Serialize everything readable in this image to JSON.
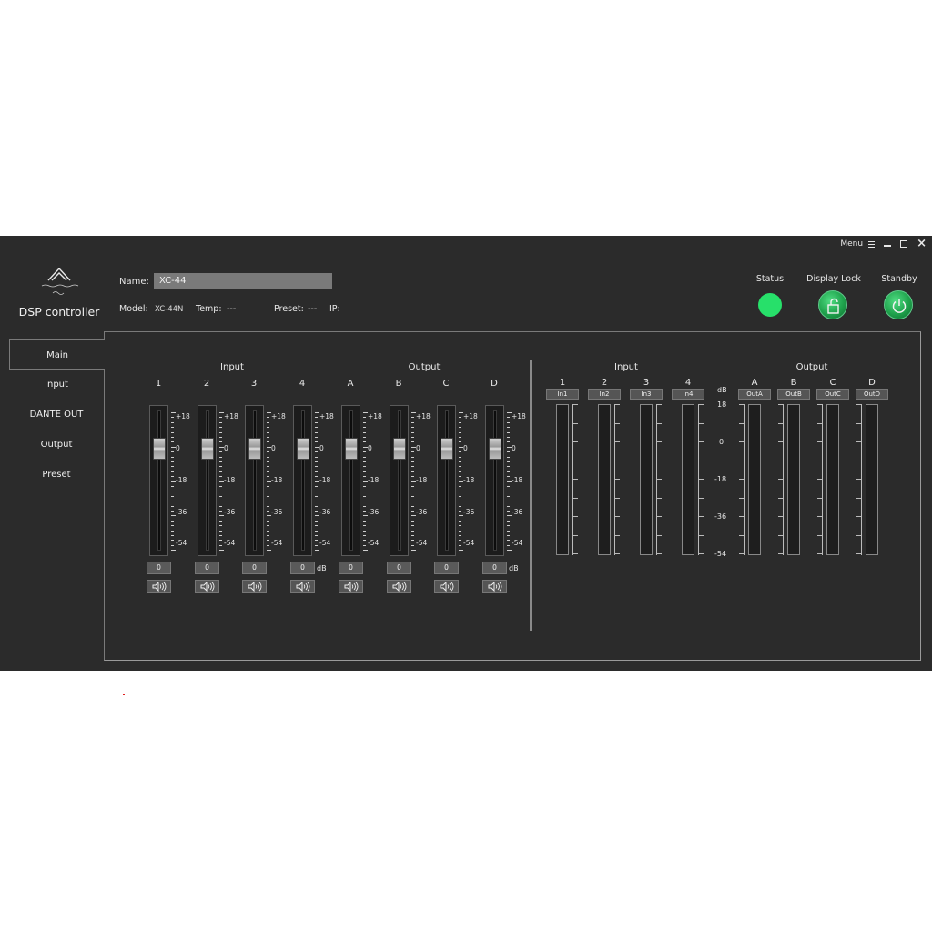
{
  "window": {
    "menu_label": "Menu"
  },
  "header": {
    "app_title": "DSP controller",
    "name_label": "Name:",
    "name_value": "XC-44",
    "model_label": "Model:",
    "model_value": "XC-44N",
    "temp_label": "Temp:",
    "temp_value": "---",
    "preset_label": "Preset:",
    "preset_value": "---",
    "ip_label": "IP:",
    "status_label": "Status",
    "display_lock_label": "Display Lock",
    "standby_label": "Standby"
  },
  "tabs": [
    "Main",
    "Input",
    "DANTE OUT",
    "Output",
    "Preset"
  ],
  "mixer": {
    "input_title": "Input",
    "output_title": "Output",
    "channels": [
      {
        "label": "1",
        "value": "0",
        "level_db": 0
      },
      {
        "label": "2",
        "value": "0",
        "level_db": 0
      },
      {
        "label": "3",
        "value": "0",
        "level_db": 0
      },
      {
        "label": "4",
        "value": "0",
        "level_db": 0
      },
      {
        "label": "A",
        "value": "0",
        "level_db": 0
      },
      {
        "label": "B",
        "value": "0",
        "level_db": 0
      },
      {
        "label": "C",
        "value": "0",
        "level_db": 0
      },
      {
        "label": "D",
        "value": "0",
        "level_db": 0
      }
    ],
    "ticks": [
      "+18",
      "0",
      "-18",
      "-36",
      "-54"
    ],
    "db_unit": "dB"
  },
  "meters": {
    "input_title": "Input",
    "output_title": "Output",
    "db_unit": "dB",
    "scale": [
      "18",
      "0",
      "-18",
      "-36",
      "-54"
    ],
    "inputs": [
      {
        "label": "1",
        "tag": "In1"
      },
      {
        "label": "2",
        "tag": "In2"
      },
      {
        "label": "3",
        "tag": "In3"
      },
      {
        "label": "4",
        "tag": "In4"
      }
    ],
    "outputs": [
      {
        "label": "A",
        "tag": "OutA"
      },
      {
        "label": "B",
        "tag": "OutB"
      },
      {
        "label": "C",
        "tag": "OutC"
      },
      {
        "label": "D",
        "tag": "OutD"
      }
    ]
  },
  "colors": {
    "status_ok": "#27e06a",
    "panel_bg": "#2b2b2b",
    "accent_green": "#1fa24c"
  }
}
